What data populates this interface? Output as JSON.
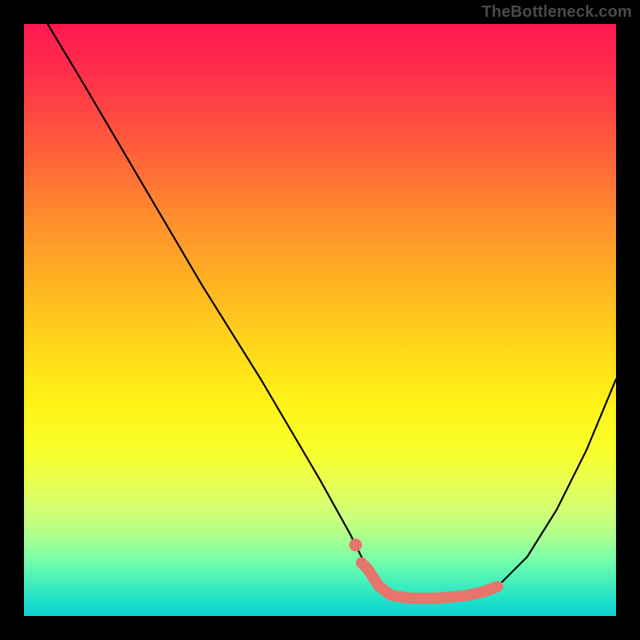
{
  "watermark": "TheBottleneck.com",
  "chart_data": {
    "type": "line",
    "title": "",
    "xlabel": "",
    "ylabel": "",
    "xlim": [
      0,
      100
    ],
    "ylim": [
      0,
      100
    ],
    "grid": false,
    "series": [
      {
        "name": "main-curve",
        "color": "#000000",
        "x": [
          4,
          10,
          20,
          30,
          40,
          50,
          55,
          58,
          60,
          62,
          65,
          70,
          75,
          80,
          85,
          90,
          95,
          100
        ],
        "y": [
          100,
          90,
          73,
          56,
          40,
          23,
          14,
          8,
          5,
          3.5,
          3,
          3,
          3.5,
          5,
          10,
          18,
          28,
          40
        ]
      },
      {
        "name": "highlight-segment",
        "color": "#e8756c",
        "x": [
          57,
          58,
          60,
          62,
          65,
          70,
          75,
          78,
          80
        ],
        "y": [
          9,
          8,
          5,
          3.5,
          3,
          3,
          3.5,
          4.2,
          5
        ]
      },
      {
        "name": "highlight-dot",
        "color": "#e8756c",
        "x": [
          56
        ],
        "y": [
          12
        ]
      }
    ],
    "background_gradient_stops": [
      {
        "pos": 0,
        "color": "#ff1850"
      },
      {
        "pos": 20,
        "color": "#ff5a3c"
      },
      {
        "pos": 44,
        "color": "#ffb422"
      },
      {
        "pos": 64,
        "color": "#fff316"
      },
      {
        "pos": 83,
        "color": "#ccff7a"
      },
      {
        "pos": 96,
        "color": "#30e8c2"
      },
      {
        "pos": 100,
        "color": "#10d4cf"
      }
    ]
  }
}
